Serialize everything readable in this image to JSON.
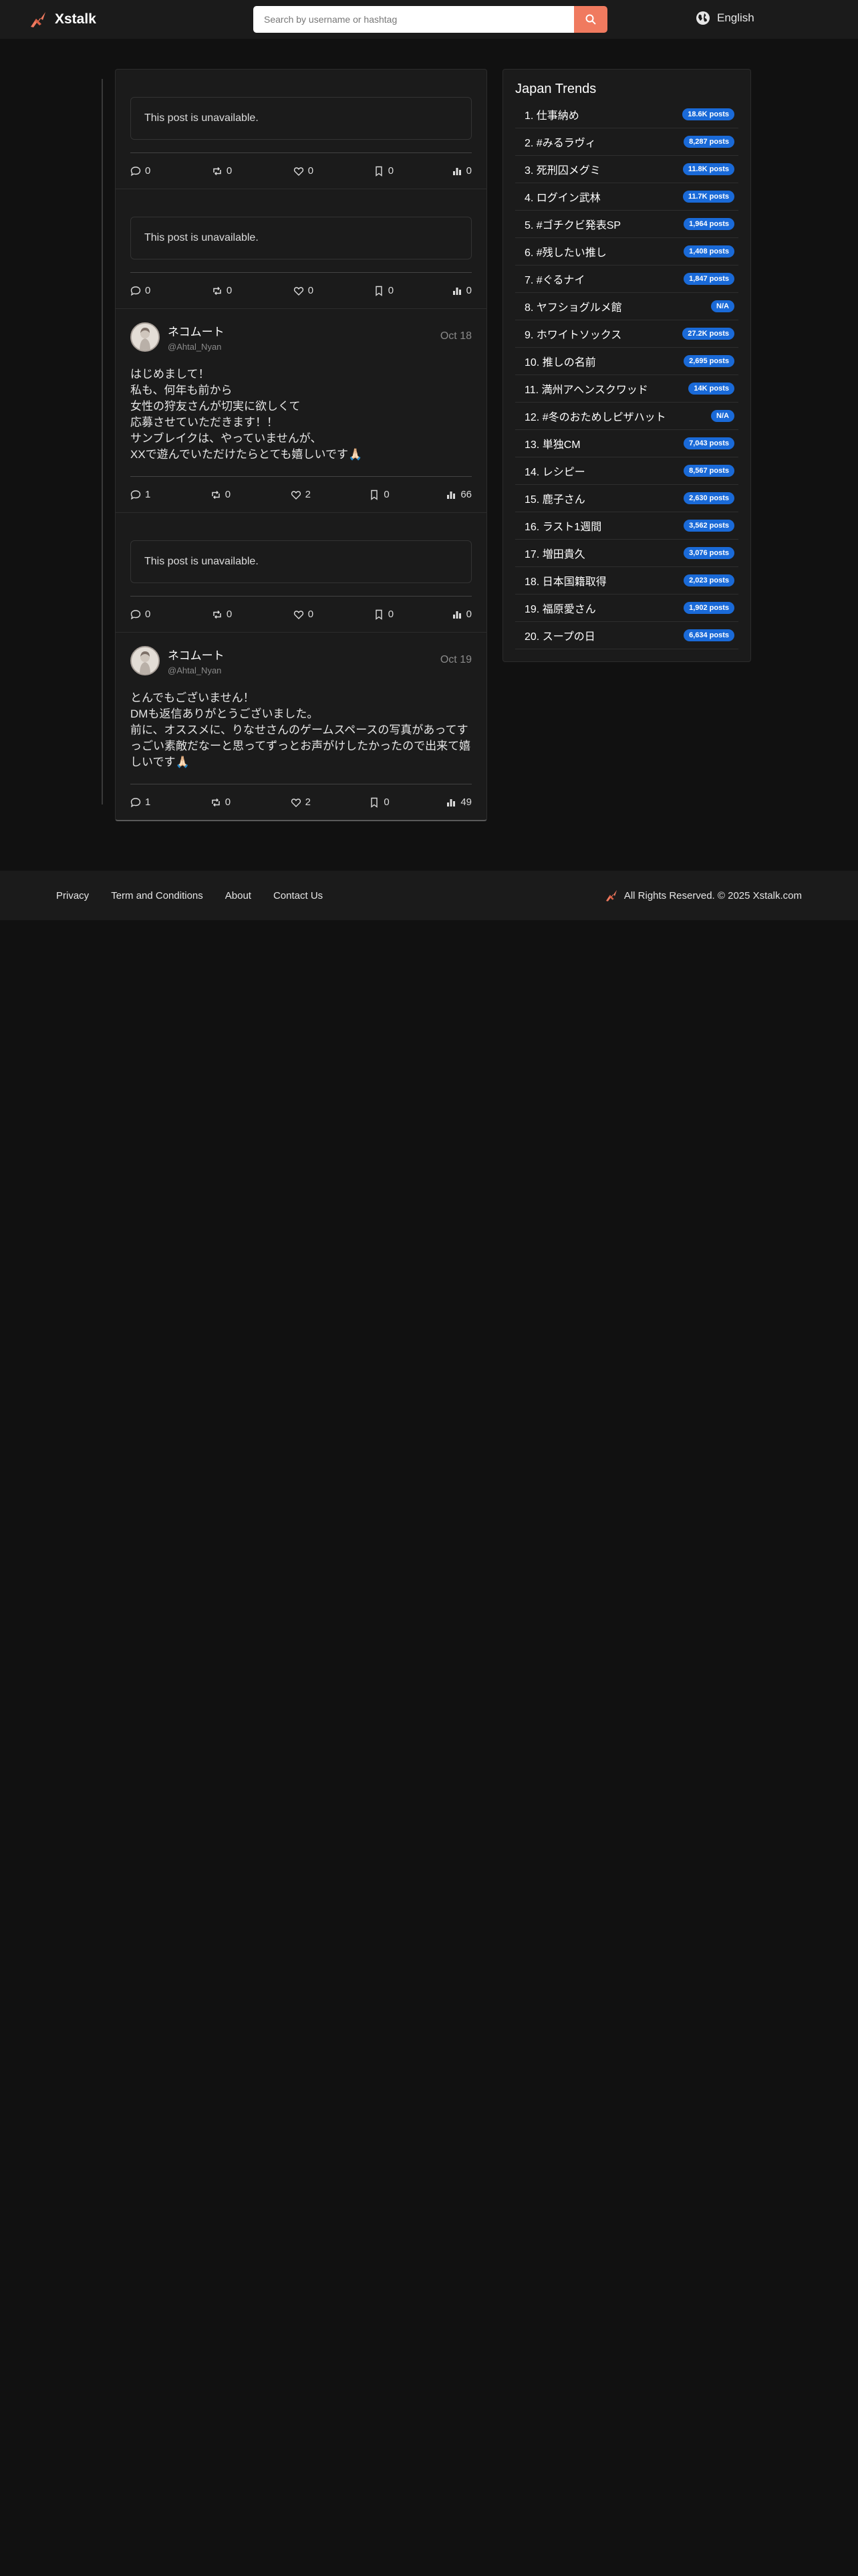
{
  "header": {
    "brand": "Xstalk",
    "search_placeholder": "Search by username or hashtag",
    "language": "English"
  },
  "posts": [
    {
      "type": "unavailable",
      "message": "This post is unavailable.",
      "replies": "0",
      "reposts": "0",
      "likes": "0",
      "bookmarks": "0",
      "views": "0"
    },
    {
      "type": "unavailable",
      "message": "This post is unavailable.",
      "replies": "0",
      "reposts": "0",
      "likes": "0",
      "bookmarks": "0",
      "views": "0"
    },
    {
      "type": "post",
      "name": "ネコムート",
      "handle": "@Ahtal_Nyan",
      "date": "Oct 18",
      "text": "はじめまして！\n私も、何年も前から\n女性の狩友さんが切実に欲しくて\n応募させていただきます！！\nサンブレイクは、やっていませんが、\nXXで遊んでいただけたらとても嬉しいです🙏🏻",
      "replies": "1",
      "reposts": "0",
      "likes": "2",
      "bookmarks": "0",
      "views": "66"
    },
    {
      "type": "unavailable",
      "message": "This post is unavailable.",
      "replies": "0",
      "reposts": "0",
      "likes": "0",
      "bookmarks": "0",
      "views": "0"
    },
    {
      "type": "post",
      "name": "ネコムート",
      "handle": "@Ahtal_Nyan",
      "date": "Oct 19",
      "text": "とんでもございません！\nDMも返信ありがとうございました。\n前に、オススメに、りなせさんのゲームスペースの写真があってすっごい素敵だなーと思ってずっとお声がけしたかったので出来て嬉しいです🙏🏻",
      "replies": "1",
      "reposts": "0",
      "likes": "2",
      "bookmarks": "0",
      "views": "49"
    }
  ],
  "trends": {
    "title": "Japan Trends",
    "items": [
      {
        "label": "1. 仕事納め",
        "count": "18.6K posts"
      },
      {
        "label": "2. #みるラヴィ",
        "count": "8,287 posts"
      },
      {
        "label": "3. 死刑囚メグミ",
        "count": "11.8K posts"
      },
      {
        "label": "4. ログイン武林",
        "count": "11.7K posts"
      },
      {
        "label": "5. #ゴチクビ発表SP",
        "count": "1,964 posts"
      },
      {
        "label": "6. #残したい推し",
        "count": "1,408 posts"
      },
      {
        "label": "7. #ぐるナイ",
        "count": "1,847 posts"
      },
      {
        "label": "8. ヤフショグルメ館",
        "count": "N/A"
      },
      {
        "label": "9. ホワイトソックス",
        "count": "27.2K posts"
      },
      {
        "label": "10. 推しの名前",
        "count": "2,695 posts"
      },
      {
        "label": "11. 満州アヘンスクワッド",
        "count": "14K posts"
      },
      {
        "label": "12. #冬のおためしピザハット",
        "count": "N/A"
      },
      {
        "label": "13. 単独CM",
        "count": "7,043 posts"
      },
      {
        "label": "14. レシピー",
        "count": "8,567 posts"
      },
      {
        "label": "15. 鹿子さん",
        "count": "2,630 posts"
      },
      {
        "label": "16. ラスト1週間",
        "count": "3,562 posts"
      },
      {
        "label": "17. 増田貴久",
        "count": "3,076 posts"
      },
      {
        "label": "18. 日本国籍取得",
        "count": "2,023 posts"
      },
      {
        "label": "19. 福原愛さん",
        "count": "1,902 posts"
      },
      {
        "label": "20. スープの日",
        "count": "6,634 posts"
      }
    ]
  },
  "footer": {
    "links": [
      "Privacy",
      "Term and Conditions",
      "About",
      "Contact Us"
    ],
    "copyright": "All Rights Reserved. © 2025 Xstalk.com"
  },
  "colors": {
    "accent": "#f07a5f",
    "badge": "#1a6ad8",
    "background": "#111111",
    "panel": "#1b1b1b"
  }
}
